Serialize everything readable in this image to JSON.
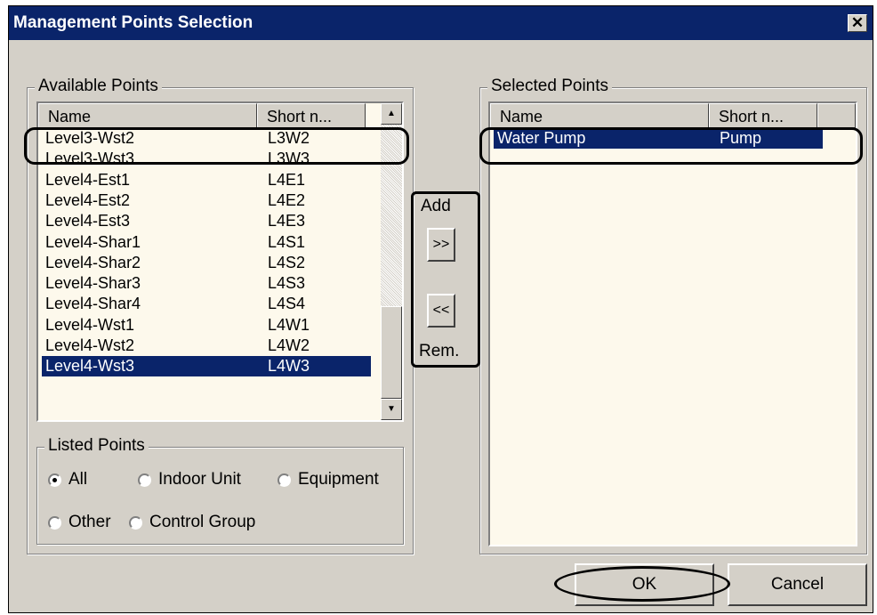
{
  "window": {
    "title": "Management Points Selection",
    "close_glyph": "✕"
  },
  "available": {
    "legend": "Available Points",
    "columns": [
      "Name",
      "Short n..."
    ],
    "rows": [
      {
        "name": "Level3-Wst2",
        "short": "L3W2"
      },
      {
        "name": "Level3-Wst3",
        "short": "L3W3"
      },
      {
        "name": "Level4-Est1",
        "short": "L4E1"
      },
      {
        "name": "Level4-Est2",
        "short": "L4E2"
      },
      {
        "name": "Level4-Est3",
        "short": "L4E3"
      },
      {
        "name": "Level4-Shar1",
        "short": "L4S1"
      },
      {
        "name": "Level4-Shar2",
        "short": "L4S2"
      },
      {
        "name": "Level4-Shar3",
        "short": "L4S3"
      },
      {
        "name": "Level4-Shar4",
        "short": "L4S4"
      },
      {
        "name": "Level4-Wst1",
        "short": "L4W1"
      },
      {
        "name": "Level4-Wst2",
        "short": "L4W2"
      },
      {
        "name": "Level4-Wst3",
        "short": "L4W3"
      }
    ],
    "selected_row": "Level4-Wst3"
  },
  "transfer": {
    "add_label": "Add",
    "add_button": ">>",
    "remove_button": "<<",
    "remove_label": "Rem."
  },
  "selected": {
    "legend": "Selected Points",
    "columns": [
      "Name",
      "Short n..."
    ],
    "rows": [
      {
        "name": "Water Pump",
        "short": "Pump"
      }
    ]
  },
  "listed_points": {
    "legend": "Listed Points",
    "options": [
      {
        "label": "All",
        "checked": true
      },
      {
        "label": "Indoor Unit",
        "checked": false
      },
      {
        "label": "Equipment",
        "checked": false
      },
      {
        "label": "Other",
        "checked": false
      },
      {
        "label": "Control Group",
        "checked": false
      }
    ]
  },
  "footer": {
    "ok_label": "OK",
    "cancel_label": "Cancel"
  },
  "colors": {
    "titlebar": "#0a246a",
    "dialog_bg": "#d4d0c8",
    "list_bg": "#fdf9ec",
    "selection": "#0a246a"
  }
}
